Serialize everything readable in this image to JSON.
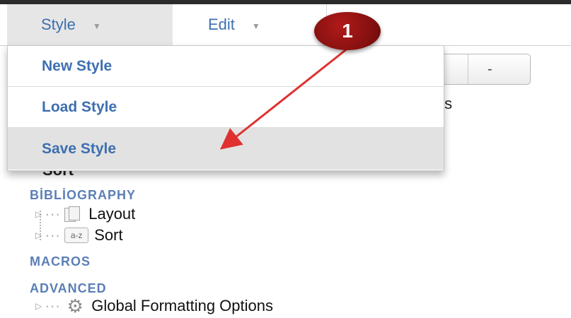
{
  "menubar": {
    "style_label": "Style",
    "edit_label": "Edit"
  },
  "dropdown": {
    "items": [
      {
        "label": "New Style"
      },
      {
        "label": "Load Style"
      },
      {
        "label": "Save Style"
      }
    ]
  },
  "background": {
    "button_minus": "-",
    "peek_text": "ıs",
    "peek_sort": "Sort"
  },
  "sections": {
    "bibliography": "BİBLİOGRAPHY",
    "macros": "MACROS",
    "advanced": "ADVANCED"
  },
  "tree": {
    "layout": "Layout",
    "sort": "Sort",
    "sort_icon_text": "a-z",
    "global": "Global Formatting Options"
  },
  "annotation": {
    "badge_number": "1",
    "color": "#e03030"
  },
  "icons": [
    "caret-down-icon",
    "pages-icon",
    "az-sort-icon",
    "gear-icon",
    "expand-triangle-icon"
  ]
}
